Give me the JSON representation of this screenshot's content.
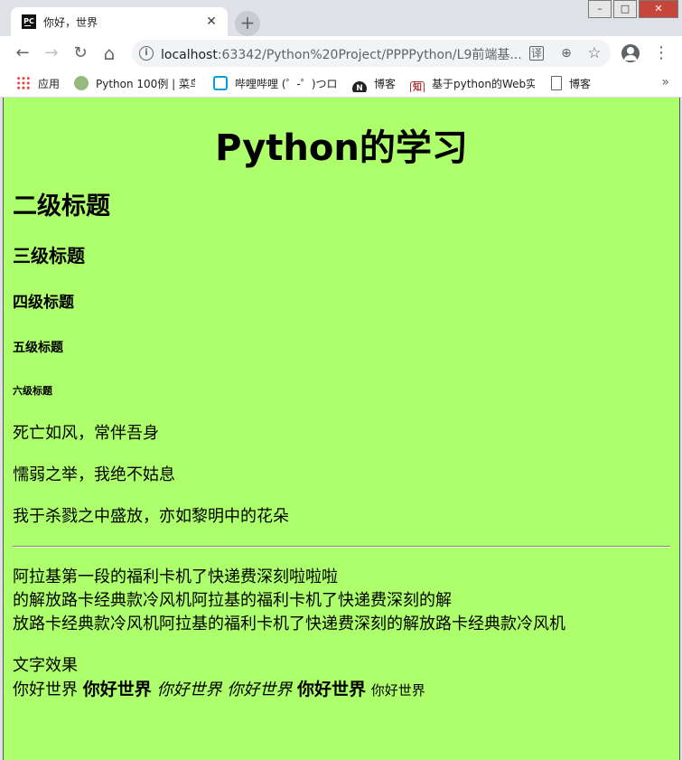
{
  "browser": {
    "tab": {
      "title": "你好，世界",
      "favicon_text": "PC",
      "close_glyph": "✕"
    },
    "new_tab_glyph": "+",
    "window_controls": {
      "minimize": "–",
      "maximize": "□",
      "close": "✕"
    },
    "nav": {
      "back": "←",
      "forward": "→",
      "reload": "↻",
      "home": "⌂"
    },
    "address_bar": {
      "host": "localhost",
      "path": ":63342/Python%20Project/PPPPython/L9前端基..."
    },
    "omnibox_icons": {
      "translate": "译",
      "zoom": "⊕",
      "bookmark_star": "☆"
    },
    "menu_glyph": "⋮",
    "bookmarks": [
      {
        "label": "应用",
        "icon": "apps-icon"
      },
      {
        "label": "Python 100例 | 菜鸟",
        "icon": "runoob-icon"
      },
      {
        "label": "哔哩哔哩 (゜-゜)つロ",
        "icon": "bilibili-icon"
      },
      {
        "label": "博客",
        "icon": "n-icon"
      },
      {
        "label": "基于python的Web实",
        "icon": "zhihu-icon"
      },
      {
        "label": "博客",
        "icon": "document-icon"
      }
    ],
    "bookmarks_overflow": "»"
  },
  "page": {
    "background": "#adff6c",
    "h1": "Python的学习",
    "h2": "二级标题",
    "h3": "三级标题",
    "h4": "四级标题",
    "h5": "五级标题",
    "h6": "六级标题",
    "quotes": [
      "死亡如风，常伴吾身",
      "懦弱之举，我绝不姑息",
      "我于杀戮之中盛放，亦如黎明中的花朵"
    ],
    "paragraph_lines": [
      "阿拉基第一段的福利卡机了快递费深刻啦啦啦",
      "的解放路卡经典款冷风机阿拉基的福利卡机了快递费深刻的解",
      "放路卡经典款冷风机阿拉基的福利卡机了快递费深刻的解放路卡经典款冷风机"
    ],
    "effects": {
      "heading": "文字效果",
      "plain": "你好世界",
      "bold": "你好世界",
      "italic1": "你好世界",
      "italic2": "你好世界",
      "strong": "你好世界",
      "small": "你好世界"
    }
  }
}
